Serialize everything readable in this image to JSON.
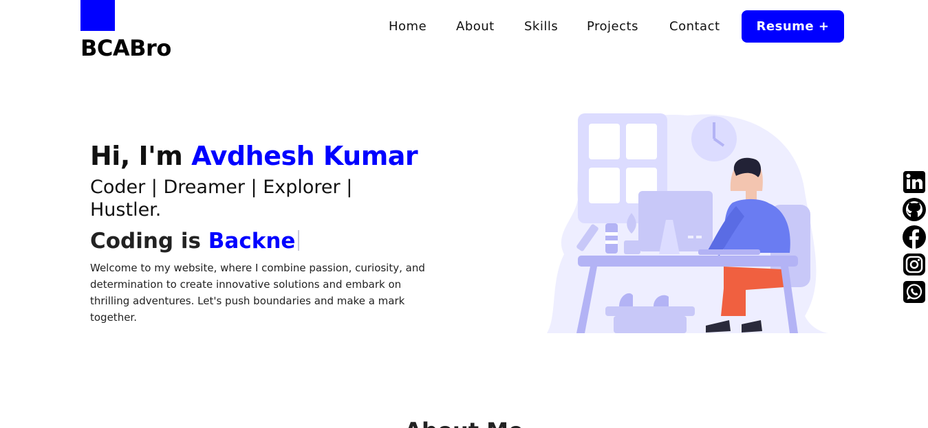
{
  "brand": {
    "name": "BCABro",
    "accent": "#0000ff"
  },
  "nav": {
    "items": [
      "Home",
      "About",
      "Skills",
      "Projects",
      "Contact"
    ],
    "resume_label": "Resume +"
  },
  "hero": {
    "greeting_prefix": "Hi, I'm",
    "name": "Avdhesh Kumar",
    "tagline": "Coder | Dreamer | Explorer | Hustler.",
    "typing_prefix": "Coding is",
    "typing_text": "Backne",
    "intro": "Welcome to my website, where I combine passion, curiosity, and determination to create innovative solutions and embark on thrilling adventures. Let's push boundaries and make a mark together."
  },
  "social": [
    "linkedin-icon",
    "github-icon",
    "facebook-icon",
    "instagram-icon",
    "whatsapp-icon"
  ],
  "next_section": {
    "title": "About Me"
  }
}
